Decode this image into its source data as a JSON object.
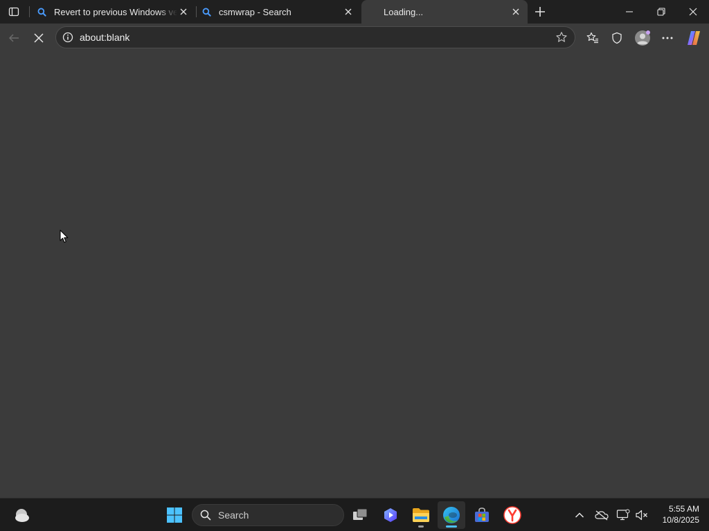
{
  "browser": {
    "tabs": [
      {
        "title": "Revert to previous Windows versi",
        "favicon": "search-icon",
        "active": false
      },
      {
        "title": "csmwrap - Search",
        "favicon": "search-icon",
        "active": false
      },
      {
        "title": "Loading...",
        "favicon": "none",
        "active": true
      }
    ],
    "address": {
      "url": "about:blank"
    }
  },
  "taskbar": {
    "search_placeholder": "Search",
    "clock": {
      "time": "5:55 AM",
      "date": "10/8/2025"
    }
  },
  "colors": {
    "tab_strip": "#202020",
    "content_bg": "#3b3b3b",
    "taskbar_bg": "#1c1c1c",
    "accent": "#4cc2ff"
  }
}
